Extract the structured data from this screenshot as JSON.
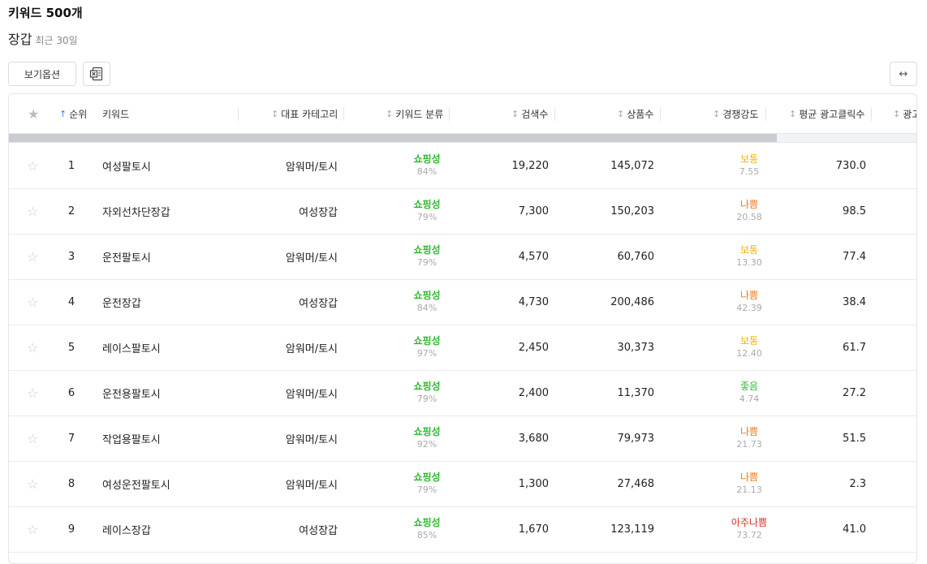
{
  "page": {
    "title": "키워드 500개",
    "category": "장갑",
    "period": "최근 30일"
  },
  "toolbar": {
    "options_label": "보기옵션",
    "excel_icon": "excel-icon",
    "expand_icon": "expand-icon",
    "expand_glyph": "↔"
  },
  "table": {
    "headers": {
      "rank": "순위",
      "keyword": "키워드",
      "category": "대표 카테고리",
      "classification": "키워드 분류",
      "search": "검색수",
      "products": "상품수",
      "competition": "경쟁강도",
      "avg_clicks": "평균 광고클릭수",
      "next": "광고"
    },
    "colors": {
      "shopping": "#2eb82e",
      "normal": "#f0b400",
      "bad": "#f07a1a",
      "very_bad": "#d93025",
      "good": "#2eb82e"
    },
    "rows": [
      {
        "rank": "1",
        "keyword": "여성팔토시",
        "category": "암워머/토시",
        "cls": "쇼핑성",
        "cls_pct": "84%",
        "search": "19,220",
        "products": "145,072",
        "comp": "보통",
        "comp_val": "7.55",
        "comp_color": "#f0b400",
        "clicks": "730.0"
      },
      {
        "rank": "2",
        "keyword": "자외선차단장갑",
        "category": "여성장갑",
        "cls": "쇼핑성",
        "cls_pct": "79%",
        "search": "7,300",
        "products": "150,203",
        "comp": "나쁨",
        "comp_val": "20.58",
        "comp_color": "#f07a1a",
        "clicks": "98.5"
      },
      {
        "rank": "3",
        "keyword": "운전팔토시",
        "category": "암워머/토시",
        "cls": "쇼핑성",
        "cls_pct": "79%",
        "search": "4,570",
        "products": "60,760",
        "comp": "보통",
        "comp_val": "13.30",
        "comp_color": "#f0b400",
        "clicks": "77.4"
      },
      {
        "rank": "4",
        "keyword": "운전장갑",
        "category": "여성장갑",
        "cls": "쇼핑성",
        "cls_pct": "84%",
        "search": "4,730",
        "products": "200,486",
        "comp": "나쁨",
        "comp_val": "42.39",
        "comp_color": "#f07a1a",
        "clicks": "38.4"
      },
      {
        "rank": "5",
        "keyword": "레이스팔토시",
        "category": "암워머/토시",
        "cls": "쇼핑성",
        "cls_pct": "97%",
        "search": "2,450",
        "products": "30,373",
        "comp": "보통",
        "comp_val": "12.40",
        "comp_color": "#f0b400",
        "clicks": "61.7"
      },
      {
        "rank": "6",
        "keyword": "운전용팔토시",
        "category": "암워머/토시",
        "cls": "쇼핑성",
        "cls_pct": "79%",
        "search": "2,400",
        "products": "11,370",
        "comp": "좋음",
        "comp_val": "4.74",
        "comp_color": "#2eb82e",
        "clicks": "27.2"
      },
      {
        "rank": "7",
        "keyword": "작업용팔토시",
        "category": "암워머/토시",
        "cls": "쇼핑성",
        "cls_pct": "92%",
        "search": "3,680",
        "products": "79,973",
        "comp": "나쁨",
        "comp_val": "21.73",
        "comp_color": "#f07a1a",
        "clicks": "51.5"
      },
      {
        "rank": "8",
        "keyword": "여성운전팔토시",
        "category": "암워머/토시",
        "cls": "쇼핑성",
        "cls_pct": "79%",
        "search": "1,300",
        "products": "27,468",
        "comp": "나쁨",
        "comp_val": "21.13",
        "comp_color": "#f07a1a",
        "clicks": "2.3"
      },
      {
        "rank": "9",
        "keyword": "레이스장갑",
        "category": "여성장갑",
        "cls": "쇼핑성",
        "cls_pct": "85%",
        "search": "1,670",
        "products": "123,119",
        "comp": "아주나쁨",
        "comp_val": "73.72",
        "comp_color": "#d93025",
        "clicks": "41.0"
      }
    ]
  }
}
